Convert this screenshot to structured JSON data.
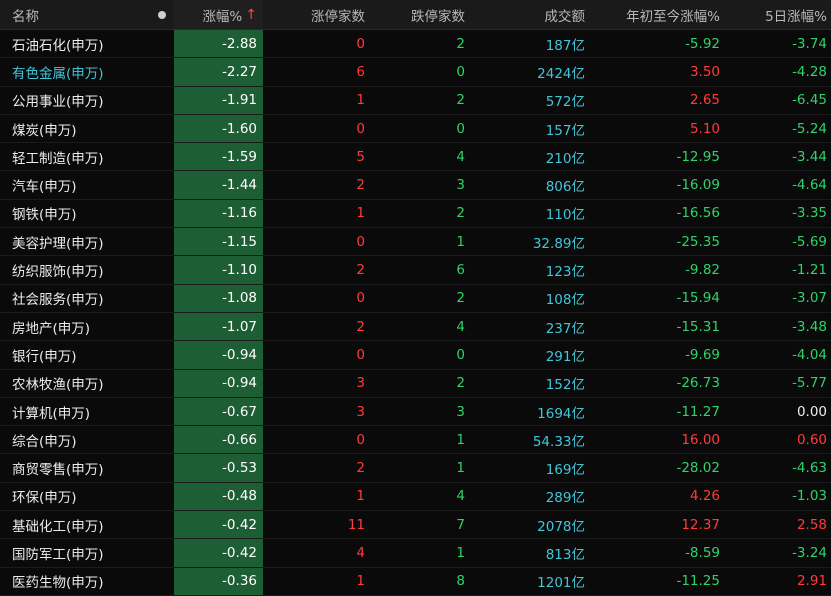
{
  "header": {
    "name": "名称",
    "change_pct": "涨幅%",
    "sort_arrow": "↑",
    "limit_up": "涨停家数",
    "limit_down": "跌停家数",
    "turnover": "成交额",
    "ytd_pct": "年初至今涨幅%",
    "five_day_pct": "5日涨幅%"
  },
  "colors": {
    "up": "#ff3b3b",
    "down": "#2fd26a",
    "turnover": "#41c6d8",
    "change_bg": "#1d5e34"
  },
  "rows": [
    {
      "name": "石油石化(申万)",
      "change": "-2.88",
      "up": "0",
      "down": "2",
      "turnover": "187亿",
      "ytd": "-5.92",
      "d5": "-3.74"
    },
    {
      "name": "有色金属(申万)",
      "change": "-2.27",
      "up": "6",
      "down": "0",
      "turnover": "2424亿",
      "ytd": "3.50",
      "d5": "-4.28"
    },
    {
      "name": "公用事业(申万)",
      "change": "-1.91",
      "up": "1",
      "down": "2",
      "turnover": "572亿",
      "ytd": "2.65",
      "d5": "-6.45"
    },
    {
      "name": "煤炭(申万)",
      "change": "-1.60",
      "up": "0",
      "down": "0",
      "turnover": "157亿",
      "ytd": "5.10",
      "d5": "-5.24"
    },
    {
      "name": "轻工制造(申万)",
      "change": "-1.59",
      "up": "5",
      "down": "4",
      "turnover": "210亿",
      "ytd": "-12.95",
      "d5": "-3.44"
    },
    {
      "name": "汽车(申万)",
      "change": "-1.44",
      "up": "2",
      "down": "3",
      "turnover": "806亿",
      "ytd": "-16.09",
      "d5": "-4.64"
    },
    {
      "name": "钢铁(申万)",
      "change": "-1.16",
      "up": "1",
      "down": "2",
      "turnover": "110亿",
      "ytd": "-16.56",
      "d5": "-3.35"
    },
    {
      "name": "美容护理(申万)",
      "change": "-1.15",
      "up": "0",
      "down": "1",
      "turnover": "32.89亿",
      "ytd": "-25.35",
      "d5": "-5.69"
    },
    {
      "name": "纺织服饰(申万)",
      "change": "-1.10",
      "up": "2",
      "down": "6",
      "turnover": "123亿",
      "ytd": "-9.82",
      "d5": "-1.21"
    },
    {
      "name": "社会服务(申万)",
      "change": "-1.08",
      "up": "0",
      "down": "2",
      "turnover": "108亿",
      "ytd": "-15.94",
      "d5": "-3.07"
    },
    {
      "name": "房地产(申万)",
      "change": "-1.07",
      "up": "2",
      "down": "4",
      "turnover": "237亿",
      "ytd": "-15.31",
      "d5": "-3.48"
    },
    {
      "name": "银行(申万)",
      "change": "-0.94",
      "up": "0",
      "down": "0",
      "turnover": "291亿",
      "ytd": "-9.69",
      "d5": "-4.04"
    },
    {
      "name": "农林牧渔(申万)",
      "change": "-0.94",
      "up": "3",
      "down": "2",
      "turnover": "152亿",
      "ytd": "-26.73",
      "d5": "-5.77"
    },
    {
      "name": "计算机(申万)",
      "change": "-0.67",
      "up": "3",
      "down": "3",
      "turnover": "1694亿",
      "ytd": "-11.27",
      "d5": "0.00"
    },
    {
      "name": "综合(申万)",
      "change": "-0.66",
      "up": "0",
      "down": "1",
      "turnover": "54.33亿",
      "ytd": "16.00",
      "d5": "0.60"
    },
    {
      "name": "商贸零售(申万)",
      "change": "-0.53",
      "up": "2",
      "down": "1",
      "turnover": "169亿",
      "ytd": "-28.02",
      "d5": "-4.63"
    },
    {
      "name": "环保(申万)",
      "change": "-0.48",
      "up": "1",
      "down": "4",
      "turnover": "289亿",
      "ytd": "4.26",
      "d5": "-1.03"
    },
    {
      "name": "基础化工(申万)",
      "change": "-0.42",
      "up": "11",
      "down": "7",
      "turnover": "2078亿",
      "ytd": "12.37",
      "d5": "2.58"
    },
    {
      "name": "国防军工(申万)",
      "change": "-0.42",
      "up": "4",
      "down": "1",
      "turnover": "813亿",
      "ytd": "-8.59",
      "d5": "-3.24"
    },
    {
      "name": "医药生物(申万)",
      "change": "-0.36",
      "up": "1",
      "down": "8",
      "turnover": "1201亿",
      "ytd": "-11.25",
      "d5": "2.91"
    }
  ]
}
